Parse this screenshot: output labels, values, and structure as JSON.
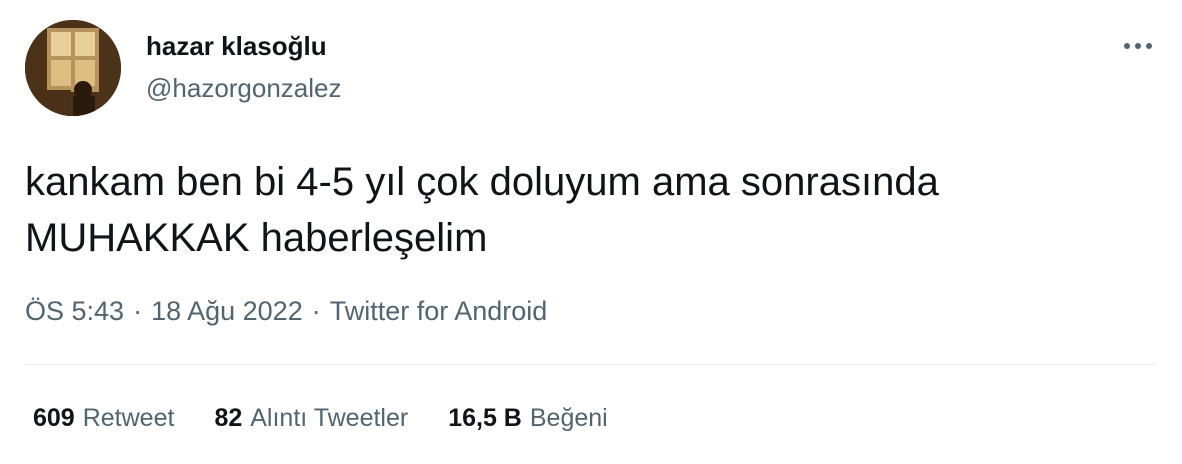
{
  "author": {
    "display_name": "hazar klasoğlu",
    "handle": "@hazorgonzalez",
    "avatar_icon": "profile-photo"
  },
  "tweet": {
    "text_lines": [
      "kankam ben bi 4-5 yıl çok doluyum ama sonrasında",
      "MUHAKKAK haberleşelim"
    ]
  },
  "meta": {
    "time": "ÖS 5:43",
    "separator": "·",
    "date": "18 Ağu 2022",
    "source": "Twitter for Android"
  },
  "stats": {
    "retweets": {
      "count": "609",
      "label": "Retweet"
    },
    "quotes": {
      "count": "82",
      "label": "Alıntı Tweetler"
    },
    "likes": {
      "count": "16,5 B",
      "label": "Beğeni"
    }
  },
  "icons": {
    "more": "more-horizontal-icon"
  },
  "colors": {
    "primary_text": "#0f1419",
    "secondary_text": "#536471",
    "divider": "#e6ecf0"
  }
}
